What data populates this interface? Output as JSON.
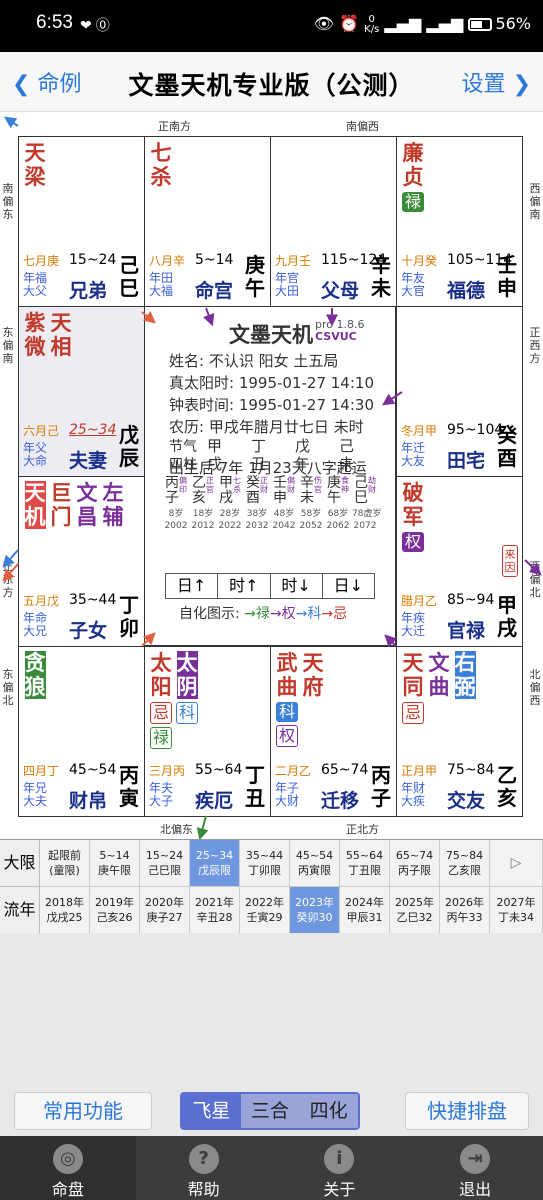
{
  "status": {
    "time": "6:53",
    "speed": "0\nK/s",
    "battery": "56%"
  },
  "nav": {
    "back": "命例",
    "title": "文墨天机专业版（公测）",
    "setting": "设置"
  },
  "directions": {
    "top1": "正南方",
    "top2": "南偏西",
    "bottom1": "北偏东",
    "bottom2": "正北方",
    "left1": "南偏东",
    "left2": "东偏南",
    "left3": "正东方",
    "left4": "东偏北",
    "right1": "西偏南",
    "right2": "正西方",
    "right3": "西偏北",
    "right4": "北偏西"
  },
  "palaces": [
    {
      "stars": [
        {
          "n": "天梁",
          "c": "red"
        }
      ],
      "stem": "七月庚",
      "range": "15~24",
      "s2": "年福 大父",
      "name": "兄弟",
      "gz": "己巳"
    },
    {
      "stars": [
        {
          "n": "七杀",
          "c": "red"
        }
      ],
      "stem": "八月辛",
      "range": "5~14",
      "s2": "年田 大福",
      "name": "命宫",
      "gz": "庚午"
    },
    {
      "stars": [],
      "stem": "九月壬",
      "range": "115~124",
      "s2": "年官 大田",
      "name": "父母",
      "gz": "辛未"
    },
    {
      "stars": [
        {
          "n": "廉贞",
          "c": "red",
          "hua": "禄",
          "hc": "lu"
        }
      ],
      "stem": "十月癸",
      "range": "105~114",
      "s2": "年友 大官",
      "name": "福德",
      "gz": "壬申"
    },
    {
      "stars": [
        {
          "n": "紫微",
          "c": "red"
        },
        {
          "n": "天相",
          "c": "red"
        }
      ],
      "stem": "六月己",
      "range": "25~34",
      "s2": "年父 大命",
      "name": "夫妻",
      "gz": "戊辰"
    },
    {
      "stars": [],
      "stem": "冬月甲",
      "range": "95~104",
      "s2": "年迁 大友",
      "name": "田宅",
      "gz": "癸酉"
    },
    {
      "stars": [
        {
          "n": "天机",
          "c": "hl"
        },
        {
          "n": "巨门",
          "c": "red"
        },
        {
          "n": "文昌",
          "c": "purple"
        },
        {
          "n": "左辅",
          "c": "purple"
        }
      ],
      "stem": "五月戊",
      "range": "35~44",
      "s2": "年命 大兄",
      "name": "子女",
      "gz": "丁卯"
    },
    {
      "stars": [
        {
          "n": "破军",
          "c": "red",
          "hua": "权",
          "hc": "quan"
        }
      ],
      "laiyin": "来因",
      "stem": "腊月乙",
      "range": "85~94",
      "s2": "年疾 大迁",
      "name": "官禄",
      "gz": "甲戌"
    },
    {
      "stars": [
        {
          "n": "贪狼",
          "c": "hlg"
        }
      ],
      "stem": "四月丁",
      "range": "45~54",
      "s2": "年兄 大夫",
      "name": "财帛",
      "gz": "丙寅"
    },
    {
      "stars": [
        {
          "n": "太阳",
          "c": "red",
          "hua": "忌",
          "hc": "ji",
          "hua2": "禄",
          "hc2": "olu"
        },
        {
          "n": "太阴",
          "c": "hlp",
          "hua": "科",
          "hc": "oke"
        }
      ],
      "stem": "三月丙",
      "range": "55~64",
      "s2": "年夫 大子",
      "name": "疾厄",
      "gz": "丁丑"
    },
    {
      "stars": [
        {
          "n": "武曲",
          "c": "red",
          "hua": "科",
          "hc": "ke",
          "hua2": "权",
          "hc2": "oquan"
        },
        {
          "n": "天府",
          "c": "red"
        }
      ],
      "stem": "二月乙",
      "range": "65~74",
      "s2": "年子 大财",
      "name": "迁移",
      "gz": "丙子"
    },
    {
      "stars": [
        {
          "n": "天同",
          "c": "red",
          "hua": "忌",
          "hc": "ji"
        },
        {
          "n": "文曲",
          "c": "purple"
        },
        {
          "n": "右弼",
          "c": "hlb"
        }
      ],
      "stem": "正月甲",
      "range": "75~84",
      "s2": "年财 大疾",
      "name": "交友",
      "gz": "乙亥"
    }
  ],
  "center": {
    "title": "文墨天机",
    "ver": "pro 1.8.6",
    "csvuc": "CSVUC",
    "line1": "姓名: 不认识    阳女 土五局",
    "line2": "真太阳时: 1995-01-27 14:10",
    "line3": "钟表时间: 1995-01-27 14:30",
    "line4": "农历: 甲戌年腊月廿七日 未时",
    "jieqi": "节气",
    "sizhu": "四柱",
    "pillars": [
      "甲戌",
      "丁丑",
      "戊午",
      "己未"
    ],
    "qiyun": "出生后 7年 1月23天八字起运",
    "dayun": [
      {
        "top": "丙",
        "shen": "偏印",
        "bot": "子",
        "age": "8岁",
        "year": "2002"
      },
      {
        "top": "乙",
        "shen": "正官",
        "bot": "亥",
        "age": "18岁",
        "year": "2012"
      },
      {
        "top": "甲",
        "shen": "七杀",
        "bot": "戌",
        "age": "28岁",
        "year": "2022"
      },
      {
        "top": "癸",
        "shen": "正财",
        "bot": "酉",
        "age": "38岁",
        "year": "2032"
      },
      {
        "top": "壬",
        "shen": "偏财",
        "bot": "申",
        "age": "48岁",
        "year": "2042"
      },
      {
        "top": "辛",
        "shen": "伤官",
        "bot": "未",
        "age": "58岁",
        "year": "2052"
      },
      {
        "top": "庚",
        "shen": "食神",
        "bot": "午",
        "age": "68岁",
        "year": "2062"
      },
      {
        "top": "己",
        "shen": "劫财",
        "bot": "巳",
        "age": "78虚岁",
        "year": "2072"
      }
    ],
    "btns": [
      "日↑",
      "时↑",
      "时↓",
      "日↓"
    ],
    "sihua_label": "自化图示:",
    "sihua": [
      {
        "t": "→禄",
        "c": "#3a8c3a"
      },
      {
        "t": "→权",
        "c": "#7a2f9a"
      },
      {
        "t": "→科",
        "c": "#3b7fd9"
      },
      {
        "t": "→忌",
        "c": "#c0392b"
      }
    ]
  },
  "daxian": {
    "label": "大限",
    "cells": [
      [
        "起限前",
        "(童限)"
      ],
      [
        "5~14",
        "庚午限"
      ],
      [
        "15~24",
        "己巳限"
      ],
      [
        "25~34",
        "戊辰限"
      ],
      [
        "35~44",
        "丁卯限"
      ],
      [
        "45~54",
        "丙寅限"
      ],
      [
        "55~64",
        "丁丑限"
      ],
      [
        "65~74",
        "丙子限"
      ],
      [
        "75~84",
        "乙亥限"
      ]
    ],
    "arrow": "▷",
    "sel": 3
  },
  "liunian": {
    "label": "流年",
    "cells": [
      [
        "2018年",
        "戊戌25"
      ],
      [
        "2019年",
        "己亥26"
      ],
      [
        "2020年",
        "庚子27"
      ],
      [
        "2021年",
        "辛丑28"
      ],
      [
        "2022年",
        "壬寅29"
      ],
      [
        "2023年",
        "癸卯30"
      ],
      [
        "2024年",
        "甲辰31"
      ],
      [
        "2025年",
        "乙巳32"
      ],
      [
        "2026年",
        "丙午33"
      ],
      [
        "2027年",
        "丁未34"
      ]
    ],
    "sel": 5
  },
  "actions": {
    "left": "常用功能",
    "right": "快捷排盘",
    "seg": [
      "飞星",
      "三合",
      "四化"
    ]
  },
  "tabs": [
    {
      "label": "命盘",
      "icon": "◎"
    },
    {
      "label": "帮助",
      "icon": "?"
    },
    {
      "label": "关于",
      "icon": "i"
    },
    {
      "label": "退出",
      "icon": "⇥"
    }
  ],
  "colors": {
    "accent": "#2b78d9",
    "red": "#c0392b",
    "purple": "#7a2f9a",
    "green": "#3a8c3a",
    "blue": "#3b7fd9",
    "selected": "#6f97e0"
  }
}
